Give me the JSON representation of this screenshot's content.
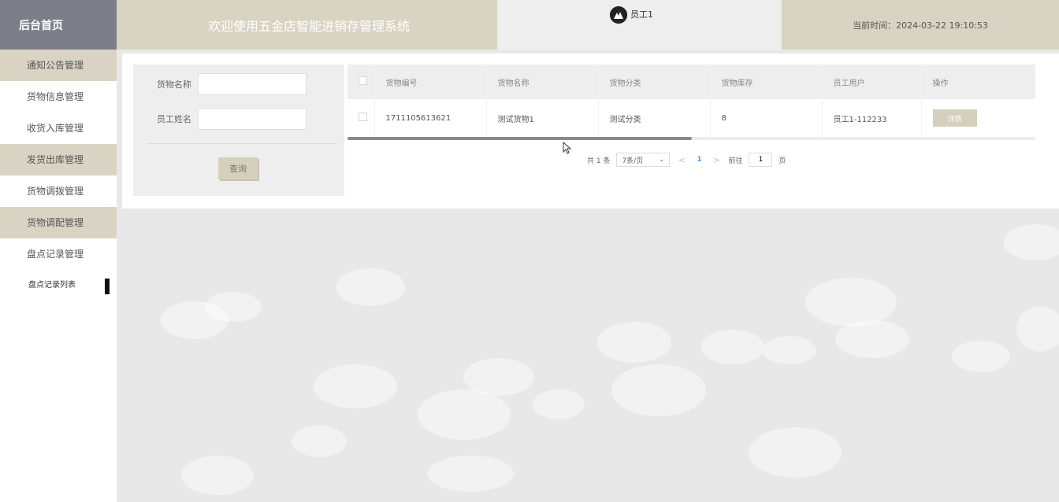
{
  "sidebar": {
    "brand": "后台首页",
    "items": [
      {
        "label": "通知公告管理"
      },
      {
        "label": "货物信息管理"
      },
      {
        "label": "收货入库管理"
      },
      {
        "label": "发货出库管理"
      },
      {
        "label": "货物调拨管理"
      },
      {
        "label": "货物调配管理"
      },
      {
        "label": "盘点记录管理"
      }
    ],
    "sub_item": "盘点记录列表"
  },
  "header": {
    "title": "欢迎使用五金店智能进销存管理系统",
    "user_name": "员工1",
    "time": "当前时间：2024-03-22 19:10:53"
  },
  "search": {
    "name_label": "货物名称",
    "name_value": "",
    "employee_label": "员工姓名",
    "employee_value": "",
    "button": "查询"
  },
  "table": {
    "columns": [
      "货物编号",
      "货物名称",
      "货物分类",
      "货物库存",
      "员工用户",
      "操作"
    ],
    "rows": [
      {
        "code": "1711105613621",
        "name": "测试货物1",
        "category": "测试分类",
        "stock": "8",
        "user": "员工1-112233",
        "action": "详情"
      }
    ]
  },
  "pagination": {
    "total": "共 1 条",
    "page_size": "7条/页",
    "prev": "<",
    "current": "1",
    "next": ">",
    "goto_label": "前往",
    "goto_value": "1",
    "goto_suffix": "页"
  },
  "colors": {
    "sidebar_brand": "#7c7f8a",
    "beige": "#d9d3c3",
    "button": "#d5cfbd",
    "active_page": "#409eff"
  }
}
